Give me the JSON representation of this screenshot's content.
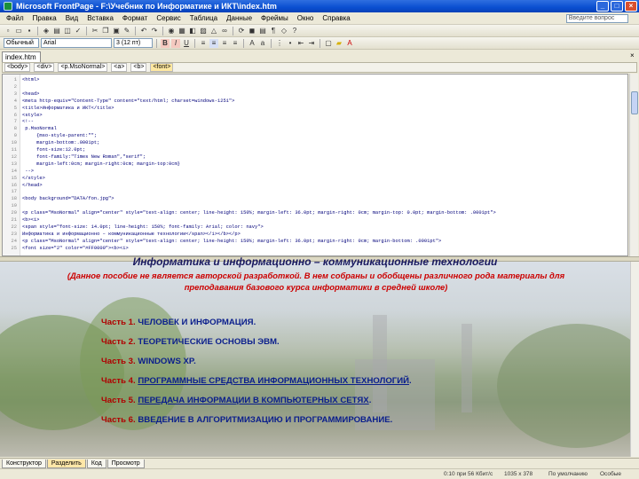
{
  "window": {
    "title": "Microsoft FrontPage - F:\\Учебник по Информатике и ИКТ\\index.htm",
    "controls": [
      "_",
      "□",
      "×"
    ]
  },
  "menu": {
    "items": [
      "Файл",
      "Правка",
      "Вид",
      "Вставка",
      "Формат",
      "Сервис",
      "Таблица",
      "Данные",
      "Фреймы",
      "Окно",
      "Справка"
    ],
    "help_placeholder": "Введите вопрос"
  },
  "toolbar2": {
    "style": "Обычный",
    "font": "Arial",
    "size": "3 (12 пт)"
  },
  "document": {
    "tab": "index.htm",
    "quick_tags": [
      "<body>",
      "<div>",
      "<p.MsoNormal>",
      "<a>",
      "<b>",
      "<font>"
    ]
  },
  "code": {
    "lines": [
      {
        "n": "1",
        "t": "<html>"
      },
      {
        "n": "2",
        "t": ""
      },
      {
        "n": "3",
        "t": "<head>"
      },
      {
        "n": "4",
        "t": "<meta http-equiv=\"Content-Type\" content=\"text/html; charset=windows-1251\">"
      },
      {
        "n": "5",
        "t": "<title>Информатика и ИКТ</title>"
      },
      {
        "n": "6",
        "t": "<style>"
      },
      {
        "n": "7",
        "t": "<!--"
      },
      {
        "n": "8",
        "t": " p.MsoNormal"
      },
      {
        "n": "9",
        "t": "     {mso-style-parent:\"\";"
      },
      {
        "n": "10",
        "t": "     margin-bottom:.0001pt;"
      },
      {
        "n": "11",
        "t": "     font-size:12.0pt;"
      },
      {
        "n": "12",
        "t": "     font-family:\"Times New Roman\",\"serif\";"
      },
      {
        "n": "13",
        "t": "     margin-left:0cm; margin-right:0cm; margin-top:0cm}"
      },
      {
        "n": "14",
        "t": " -->"
      },
      {
        "n": "15",
        "t": "</style>"
      },
      {
        "n": "16",
        "t": "</head>"
      },
      {
        "n": "17",
        "t": ""
      },
      {
        "n": "18",
        "t": "<body background=\"DATA/fon.jpg\">"
      },
      {
        "n": "19",
        "t": ""
      },
      {
        "n": "20",
        "t": "<p class=\"MsoNormal\" align=\"center\" style=\"text-align: center; line-height: 150%; margin-left: 36.0pt; margin-right: 0cm; margin-top: 0.0pt; margin-bottom: .0001pt\">"
      },
      {
        "n": "21",
        "t": "<b><i>"
      },
      {
        "n": "22",
        "t": "<span style=\"font-size: 14.0pt; line-height: 150%; font-family: Arial; color: navy\">"
      },
      {
        "n": "23",
        "t": "Информатика и информационно – коммуникационные технологии</span></i></b></p>"
      },
      {
        "n": "24",
        "t": "<p class=\"MsoNormal\" align=\"center\" style=\"text-align: center; line-height: 150%; margin-left: 36.0pt; margin-right: 0cm; margin-bottom: .0001pt\">"
      },
      {
        "n": "25",
        "t": "<font size=\"2\" color=\"#FF0000\"><b><i>"
      }
    ]
  },
  "page": {
    "title": "Информатика и информационно – коммуникационные технологии",
    "note": "(Данное пособие не является авторской разработкой. В нем собраны и обобщены различного рода материалы для преподавания базового курса информатики в средней школе)",
    "parts": [
      {
        "num": "Часть 1.",
        "title": "ЧЕЛОВЕК И ИНФОРМАЦИЯ",
        "suffix": ".",
        "link": false
      },
      {
        "num": "Часть 2.",
        "title": "ТЕОРЕТИЧЕСКИЕ ОСНОВЫ ЭВМ",
        "suffix": ".",
        "link": false
      },
      {
        "num": "Часть 3.",
        "title": "WINDOWS XP",
        "suffix": ".",
        "link": false
      },
      {
        "num": "Часть 4.",
        "title": "ПРОГРАММНЫЕ СРЕДСТВА ИНФОРМАЦИОННЫХ ТЕХНОЛОГИЙ",
        "suffix": ".",
        "link": true
      },
      {
        "num": "Часть 5.",
        "title": "ПЕРЕДАЧА ИНФОРМАЦИИ В КОМПЬЮТЕРНЫХ СЕТЯХ",
        "suffix": ".",
        "link": true
      },
      {
        "num": "Часть 6.",
        "title": "ВВЕДЕНИЕ В АЛГОРИТМИЗАЦИЮ И ПРОГРАММИРОВАНИЕ",
        "suffix": ".",
        "link": false
      }
    ]
  },
  "view_tabs": [
    "Конструктор",
    "Разделить",
    "Код",
    "Просмотр"
  ],
  "status": {
    "connection": "0:10 при 56 Кбит/с",
    "size": "1035 x 378",
    "mode": "По умолчанию",
    "doc": "Особые"
  }
}
